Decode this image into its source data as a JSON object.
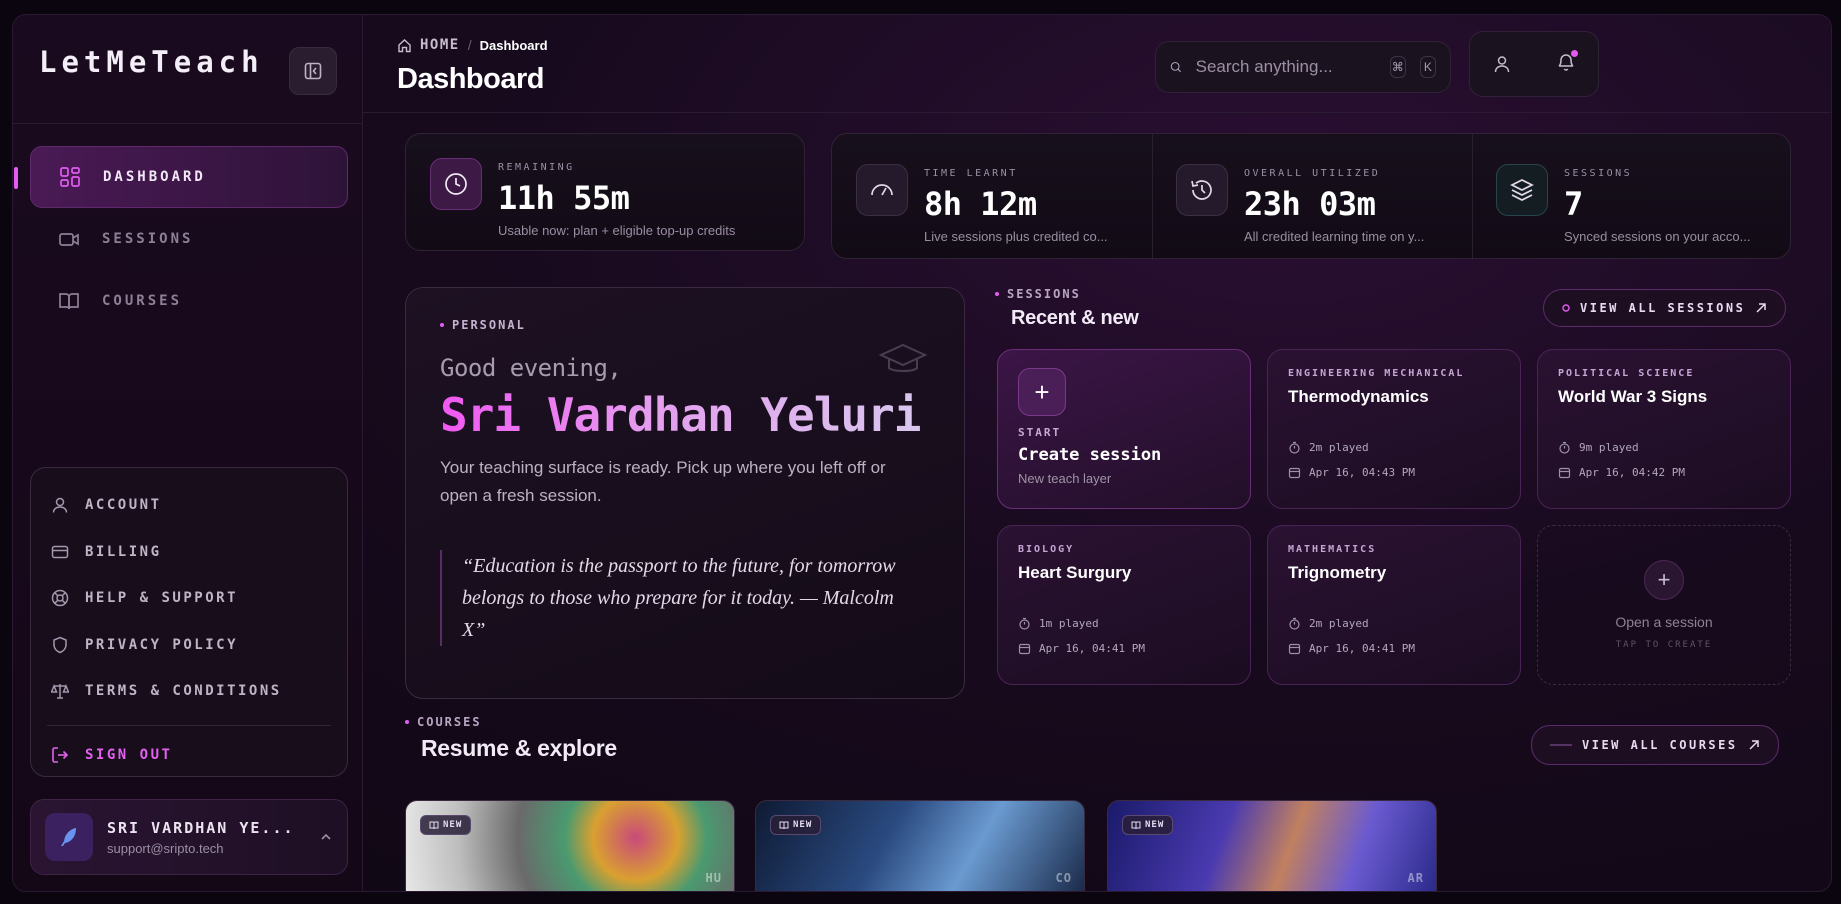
{
  "sidebar": {
    "brand": "LetMeTeach",
    "nav": [
      {
        "label": "DASHBOARD",
        "icon": "grid-icon",
        "active": true
      },
      {
        "label": "SESSIONS",
        "icon": "video-icon",
        "active": false
      },
      {
        "label": "COURSES",
        "icon": "book-icon",
        "active": false
      }
    ],
    "menu": [
      {
        "label": "ACCOUNT",
        "icon": "user-icon"
      },
      {
        "label": "BILLING",
        "icon": "card-icon"
      },
      {
        "label": "HELP & SUPPORT",
        "icon": "lifebuoy-icon"
      },
      {
        "label": "PRIVACY POLICY",
        "icon": "shield-icon"
      },
      {
        "label": "TERMS & CONDITIONS",
        "icon": "scale-icon"
      }
    ],
    "signout": "SIGN OUT",
    "user": {
      "name": "SRI VARDHAN YE...",
      "email": "support@sripto.tech"
    }
  },
  "header": {
    "breadcrumb_home": "HOME",
    "breadcrumb_sep": "/",
    "breadcrumb_current": "Dashboard",
    "title": "Dashboard",
    "search_placeholder": "Search anything...",
    "kbd_cmd": "⌘",
    "kbd_key": "K"
  },
  "stats": [
    {
      "label": "REMAINING",
      "value": "11h 55m",
      "sub": "Usable now: plan + eligible top-up credits",
      "icon": "clock-icon"
    },
    {
      "label": "TIME LEARNT",
      "value": "8h 12m",
      "sub": "Live sessions plus credited co...",
      "icon": "gauge-icon"
    },
    {
      "label": "OVERALL UTILIZED",
      "value": "23h 03m",
      "sub": "All credited learning time on y...",
      "icon": "history-icon"
    },
    {
      "label": "SESSIONS",
      "value": "7",
      "sub": "Synced sessions on your acco...",
      "icon": "layers-icon"
    }
  ],
  "welcome": {
    "tag": "PERSONAL",
    "greeting": "Good evening,",
    "name": "Sri Vardhan Yeluri",
    "description": "Your teaching surface is ready. Pick up where you left off or open a fresh session.",
    "quote": "“Education is the passport to the future, for tomorrow belongs to those who prepare for it today. — Malcolm X”"
  },
  "sessions": {
    "tag": "SESSIONS",
    "title": "Recent & new",
    "view_all": "VIEW ALL SESSIONS",
    "create": {
      "start": "START",
      "title": "Create session",
      "sub": "New teach layer",
      "plus": "+"
    },
    "items": [
      {
        "subject": "ENGINEERING MECHANICAL",
        "title": "Thermodynamics",
        "played": "2m played",
        "date": "Apr 16, 04:43 PM"
      },
      {
        "subject": "POLITICAL SCIENCE",
        "title": "World War 3 Signs",
        "played": "9m played",
        "date": "Apr 16, 04:42 PM"
      },
      {
        "subject": "BIOLOGY",
        "title": "Heart Surgury",
        "played": "1m played",
        "date": "Apr 16, 04:41 PM"
      },
      {
        "subject": "MATHEMATICS",
        "title": "Trignometry",
        "played": "2m played",
        "date": "Apr 16, 04:41 PM"
      }
    ],
    "empty": {
      "title": "Open a session",
      "sub": "TAP TO CREATE",
      "plus": "+"
    }
  },
  "courses": {
    "tag": "COURSES",
    "title": "Resume & explore",
    "view_all": "VIEW ALL COURSES",
    "items": [
      {
        "badge": "NEW",
        "code": "HU"
      },
      {
        "badge": "NEW",
        "code": "CO"
      },
      {
        "badge": "NEW",
        "code": "AR"
      }
    ]
  }
}
